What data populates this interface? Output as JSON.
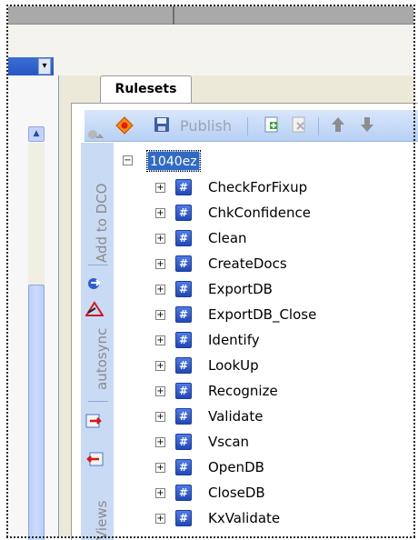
{
  "tabs": {
    "rulesets": "Rulesets"
  },
  "toolbar": {
    "publish_label": "Publish",
    "icons": [
      "diamond-icon",
      "save-icon",
      "add-document-icon",
      "delete-document-icon",
      "move-up-icon",
      "move-down-icon"
    ]
  },
  "left_pane": {
    "header_button": "▾",
    "scroll_up": "▲"
  },
  "sidebar": {
    "add_to_dco": "Add to DCO",
    "autosync": "autosync",
    "views": "Views"
  },
  "tree": {
    "root": {
      "label": "1040ez",
      "toggle": "−"
    },
    "children": [
      {
        "label": "CheckForFixup",
        "toggle": "+"
      },
      {
        "label": "ChkConfidence",
        "toggle": "+"
      },
      {
        "label": "Clean",
        "toggle": "+"
      },
      {
        "label": "CreateDocs",
        "toggle": "+"
      },
      {
        "label": "ExportDB",
        "toggle": "+"
      },
      {
        "label": "ExportDB_Close",
        "toggle": "+"
      },
      {
        "label": "Identify",
        "toggle": "+"
      },
      {
        "label": "LookUp",
        "toggle": "+"
      },
      {
        "label": "Recognize",
        "toggle": "+"
      },
      {
        "label": "Validate",
        "toggle": "+"
      },
      {
        "label": "Vscan",
        "toggle": "+"
      },
      {
        "label": "OpenDB",
        "toggle": "+"
      },
      {
        "label": "CloseDB",
        "toggle": "+"
      },
      {
        "label": "KxValidate",
        "toggle": "+"
      }
    ]
  },
  "colors": {
    "selection": "#316ac5",
    "toolbar": "#c8dcf7",
    "sidebar": "#c9daf4"
  }
}
